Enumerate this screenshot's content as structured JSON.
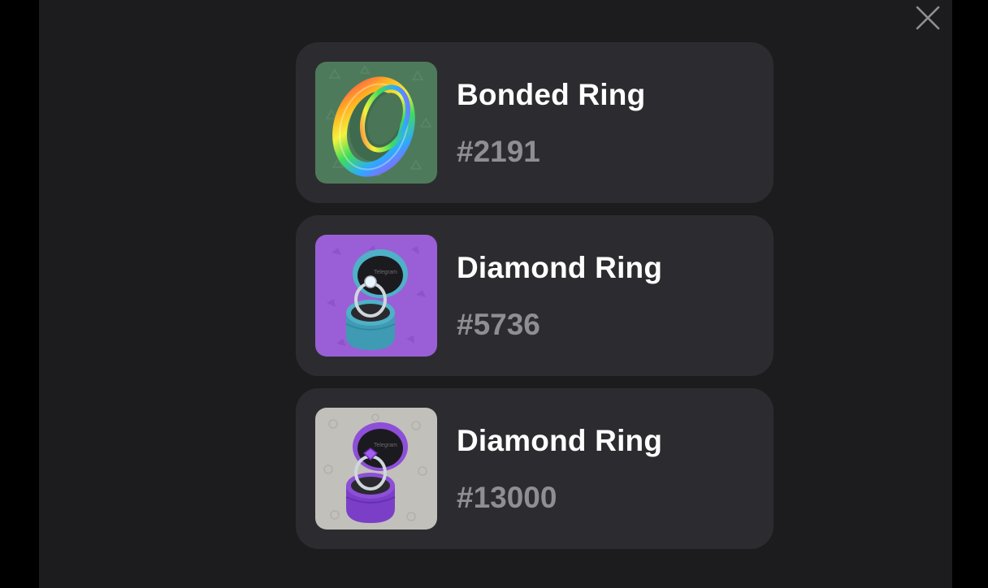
{
  "close_button": {
    "icon": "close-icon",
    "color": "#8e8e93"
  },
  "gifts": [
    {
      "name": "Bonded Ring",
      "number": "#2191",
      "thumbnail": {
        "icon": "rainbow-ring-icon",
        "background": "#4e7a5c"
      }
    },
    {
      "name": "Diamond Ring",
      "number": "#5736",
      "thumbnail": {
        "icon": "blue-ring-box-icon",
        "background": "#9a5fd6"
      }
    },
    {
      "name": "Diamond Ring",
      "number": "#13000",
      "thumbnail": {
        "icon": "purple-ring-box-icon",
        "background": "#c2c0bb"
      }
    }
  ],
  "colors": {
    "page_background": "#000000",
    "panel_background": "#1c1c1e",
    "card_background": "#2c2c30",
    "title_text": "#ffffff",
    "number_text": "#8e8e93"
  }
}
